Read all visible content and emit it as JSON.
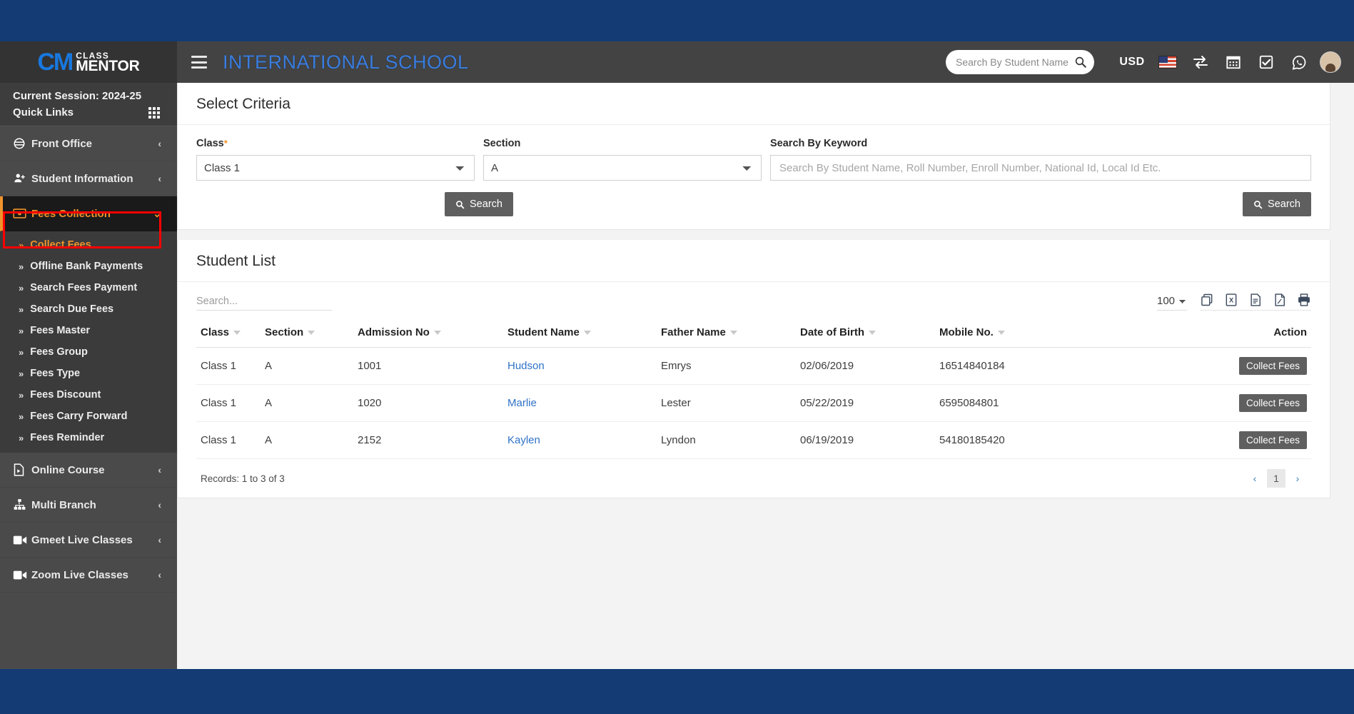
{
  "brand": {
    "logo_mark": "CM",
    "logo_line1": "CLASS",
    "logo_line2": "MENTOR"
  },
  "header": {
    "school_title": "INTERNATIONAL SCHOOL",
    "search_placeholder": "Search By Student Name",
    "search_value": "",
    "currency": "USD",
    "icons": [
      "search-icon",
      "us-flag-icon",
      "transfer-icon",
      "calendar-icon",
      "checkbox-icon",
      "whatsapp-icon",
      "avatar"
    ]
  },
  "sidebar": {
    "session_label": "Current Session: 2024-25",
    "quick_links_label": "Quick Links",
    "items": [
      {
        "label": "Front Office",
        "icon": "front-office-icon",
        "caret": "‹",
        "active": false
      },
      {
        "label": "Student Information",
        "icon": "student-icon",
        "caret": "‹",
        "active": false
      },
      {
        "label": "Fees Collection",
        "icon": "money-icon",
        "caret": "⌄",
        "active": true
      },
      {
        "label": "Online Course",
        "icon": "online-course-icon",
        "caret": "‹",
        "active": false
      },
      {
        "label": "Multi Branch",
        "icon": "branch-icon",
        "caret": "‹",
        "active": false
      },
      {
        "label": "Gmeet Live Classes",
        "icon": "video-icon",
        "caret": "‹",
        "active": false
      },
      {
        "label": "Zoom Live Classes",
        "icon": "video-icon",
        "caret": "‹",
        "active": false
      }
    ],
    "submenu": [
      {
        "label": "Collect Fees",
        "current": true
      },
      {
        "label": "Offline Bank Payments",
        "current": false
      },
      {
        "label": "Search Fees Payment",
        "current": false
      },
      {
        "label": "Search Due Fees",
        "current": false
      },
      {
        "label": "Fees Master",
        "current": false
      },
      {
        "label": "Fees Group",
        "current": false
      },
      {
        "label": "Fees Type",
        "current": false
      },
      {
        "label": "Fees Discount",
        "current": false
      },
      {
        "label": "Fees Carry Forward",
        "current": false
      },
      {
        "label": "Fees Reminder",
        "current": false
      }
    ]
  },
  "criteria": {
    "title": "Select Criteria",
    "class_label": "Class",
    "class_required": "*",
    "class_value": "Class 1",
    "section_label": "Section",
    "section_value": "A",
    "keyword_label": "Search By Keyword",
    "keyword_placeholder": "Search By Student Name, Roll Number, Enroll Number, National Id, Local Id Etc.",
    "keyword_value": "",
    "search_button": "Search",
    "search_button_right": "Search"
  },
  "student_list": {
    "title": "Student List",
    "search_placeholder": "Search...",
    "search_value": "",
    "page_length": "100",
    "export_icons": [
      "copy-icon",
      "excel-icon",
      "csv-icon",
      "pdf-icon",
      "print-icon"
    ],
    "columns": [
      "Class",
      "Section",
      "Admission No",
      "Student Name",
      "Father Name",
      "Date of Birth",
      "Mobile No.",
      "Action"
    ],
    "rows": [
      {
        "class": "Class 1",
        "section": "A",
        "admission_no": "1001",
        "student_name": "Hudson",
        "father_name": "Emrys",
        "dob": "02/06/2019",
        "mobile": "16514840184",
        "action": "Collect Fees"
      },
      {
        "class": "Class 1",
        "section": "A",
        "admission_no": "1020",
        "student_name": "Marlie",
        "father_name": "Lester",
        "dob": "05/22/2019",
        "mobile": "6595084801",
        "action": "Collect Fees"
      },
      {
        "class": "Class 1",
        "section": "A",
        "admission_no": "2152",
        "student_name": "Kaylen",
        "father_name": "Lyndon",
        "dob": "06/19/2019",
        "mobile": "54180185420",
        "action": "Collect Fees"
      }
    ],
    "records_text": "Records: 1 to 3 of 3",
    "pager": {
      "prev": "‹",
      "current": "1",
      "next": "›"
    }
  },
  "colors": {
    "top_band": "#143b73",
    "header": "#434343",
    "sidebar": "#4a4a4a",
    "accent": "#f0922b",
    "link": "#2f72c7",
    "highlight_outline": "#ff0000",
    "button": "#5f5f5f"
  }
}
